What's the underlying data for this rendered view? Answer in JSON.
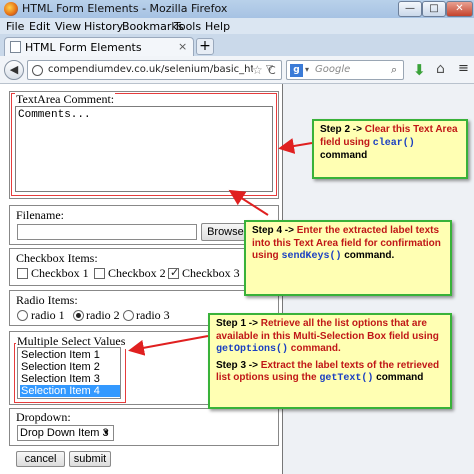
{
  "window": {
    "title": "HTML Form Elements - Mozilla Firefox"
  },
  "menu": [
    "File",
    "Edit",
    "View",
    "History",
    "Bookmarks",
    "Tools",
    "Help"
  ],
  "tab": {
    "label": "HTML Form Elements",
    "close": "×"
  },
  "nav": {
    "url": "compendiumdev.co.uk/selenium/basic_html_f",
    "search_placeholder": "Google"
  },
  "form": {
    "textarea_legend": "TextArea Comment:",
    "textarea_value": "Comments...",
    "filename_label": "Filename:",
    "browse_label": "Browse...",
    "checkbox_legend": "Checkbox Items:",
    "checkboxes": [
      {
        "label": "Checkbox 1",
        "checked": false
      },
      {
        "label": "Checkbox 2",
        "checked": false
      },
      {
        "label": "Checkbox 3",
        "checked": true
      }
    ],
    "radio_legend": "Radio Items:",
    "radios": [
      {
        "label": "radio 1",
        "checked": false
      },
      {
        "label": "radio 2",
        "checked": true
      },
      {
        "label": "radio 3",
        "checked": false
      }
    ],
    "multiselect_legend": "Multiple Select Values",
    "multiselect_options": [
      "Selection Item 1",
      "Selection Item 2",
      "Selection Item 3",
      "Selection Item 4"
    ],
    "multiselect_selected_index": 3,
    "dropdown_legend": "Dropdown:",
    "dropdown_value": "Drop Down Item 3",
    "cancel_label": "cancel",
    "submit_label": "submit"
  },
  "callouts": {
    "step2": {
      "prefix": "Step 2 ->",
      "text": "Clear this Text Area field using",
      "code": "clear()",
      "suffix": "command"
    },
    "step4": {
      "prefix": "Step 4 ->",
      "text": "Enter the extracted label texts into this Text Area field for confirmation using",
      "code": "sendKeys()",
      "suffix": "command."
    },
    "step1": {
      "prefix": "Step 1 ->",
      "text": "Retrieve all  the list options that are available in this Multi-Selection Box field using",
      "code": "getOptions()",
      "suffix": "command."
    },
    "step3": {
      "prefix": "Step 3 ->",
      "text": "Extract the label texts of the retrieved list options using the",
      "code": "getText()",
      "suffix": "command"
    }
  },
  "colors": {
    "callout_border": "#39b239",
    "callout_bg": "#ffffb3",
    "callout_text": "#c01717",
    "arrow": "#e02020",
    "highlight": "#3399ff"
  }
}
